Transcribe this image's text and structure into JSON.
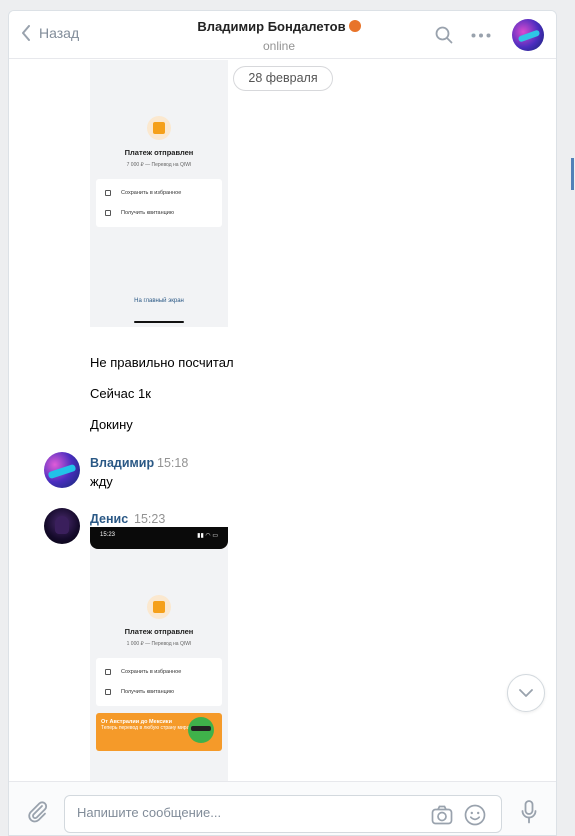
{
  "header": {
    "back_label": "Назад",
    "title": "Владимир Бондалетов",
    "status": "online"
  },
  "chat": {
    "date_divider": "28 февраля",
    "screenshot1": {
      "title": "Платеж отправлен",
      "subtitle": "7 000 ₽ — Перевод на QIWI",
      "rows": [
        "Сохранить в избранное",
        "Получить квитанцию"
      ],
      "link": "На главный экран"
    },
    "messages": [
      {
        "text": "Не правильно посчитал"
      },
      {
        "text": "Сейчас 1к"
      },
      {
        "text": "Докину"
      }
    ],
    "vladimir": {
      "name": "Владимир",
      "time": "15:18",
      "text": "жду"
    },
    "denis": {
      "name": "Денис",
      "time": "15:23"
    },
    "screenshot2": {
      "status_time": "15:23",
      "title": "Платеж отправлен",
      "subtitle": "1 000 ₽ — Перевод на QIWI",
      "rows": [
        "Сохранить в избранное",
        "Получить квитанцию"
      ],
      "promo_title": "От Австралии до Мексики",
      "promo_text": "Теперь перевод в любую страну мира"
    }
  },
  "composer": {
    "placeholder": "Напишите сообщение..."
  },
  "colors": {
    "link": "#2a5885",
    "muted": "#939393",
    "accent_orange": "#f59a29"
  },
  "icons": [
    "chevron-left-icon",
    "search-icon",
    "more-icon",
    "chevron-down-icon",
    "paperclip-icon",
    "camera-icon",
    "smile-icon",
    "microphone-icon"
  ]
}
